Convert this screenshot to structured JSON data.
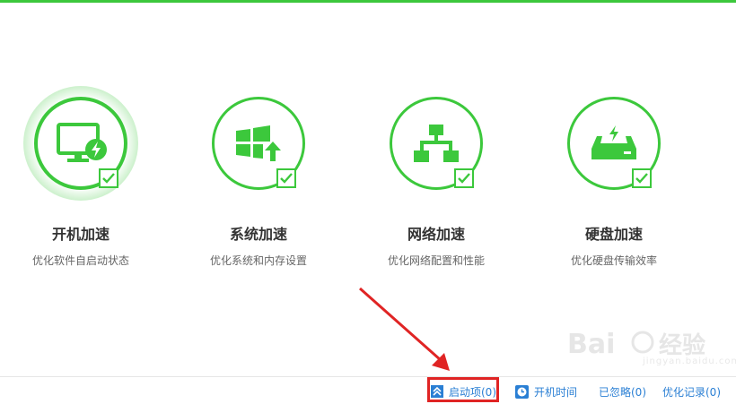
{
  "cards": [
    {
      "title": "开机加速",
      "subtitle": "优化软件自启动状态",
      "icon": "monitor-bolt-icon",
      "active": true
    },
    {
      "title": "系统加速",
      "subtitle": "优化系统和内存设置",
      "icon": "windows-upload-icon",
      "active": false
    },
    {
      "title": "网络加速",
      "subtitle": "优化网络配置和性能",
      "icon": "network-topology-icon",
      "active": false
    },
    {
      "title": "硬盘加速",
      "subtitle": "优化硬盘传输效率",
      "icon": "hard-drive-bolt-icon",
      "active": false
    }
  ],
  "footer": {
    "startup_items": "启动项(0)",
    "boot_time": "开机时间",
    "ignored": "已忽略(0)",
    "history": "优化记录(0)"
  },
  "watermark": {
    "brand": "Bai",
    "brand_cn": "经验",
    "url": "jingyan.baidu.com"
  },
  "colors": {
    "accent": "#3cc83c",
    "link": "#2a7fd4",
    "highlight": "#e02424"
  }
}
